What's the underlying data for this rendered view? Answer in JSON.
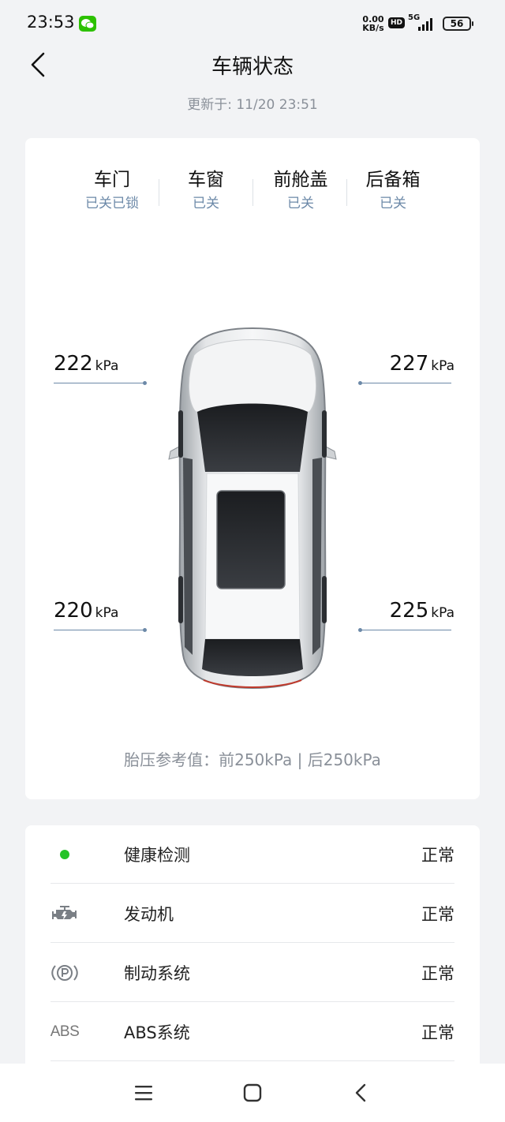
{
  "status_bar": {
    "time": "23:53",
    "net_speed_value": "0.00",
    "net_speed_unit": "KB/s",
    "hd": "HD",
    "network": "5G",
    "battery": "56",
    "icons": [
      "wechat-icon",
      "signal-icon",
      "battery-icon"
    ]
  },
  "header": {
    "title": "车辆状态",
    "updated": "更新于: 11/20 23:51"
  },
  "status": {
    "items": [
      {
        "label": "车门",
        "value": "已关已锁"
      },
      {
        "label": "车窗",
        "value": "已关"
      },
      {
        "label": "前舱盖",
        "value": "已关"
      },
      {
        "label": "后备箱",
        "value": "已关"
      }
    ]
  },
  "tires": {
    "front_left": {
      "value": "222",
      "unit": "kPa"
    },
    "front_right": {
      "value": "227",
      "unit": "kPa"
    },
    "rear_left": {
      "value": "220",
      "unit": "kPa"
    },
    "rear_right": {
      "value": "225",
      "unit": "kPa"
    },
    "reference": "胎压参考值：前250kPa | 后250kPa"
  },
  "health": {
    "rows": [
      {
        "icon": "status-dot-icon",
        "label": "健康检测",
        "status": "正常"
      },
      {
        "icon": "engine-icon",
        "label": "发动机",
        "status": "正常"
      },
      {
        "icon": "parking-brake-icon",
        "label": "制动系统",
        "status": "正常"
      },
      {
        "icon": "abs-icon",
        "icon_text": "ABS",
        "label": "ABS系统",
        "status": "正常"
      }
    ]
  },
  "colors": {
    "accent": "#6c89a8",
    "ok": "#25c328",
    "background": "#f2f3f5"
  }
}
